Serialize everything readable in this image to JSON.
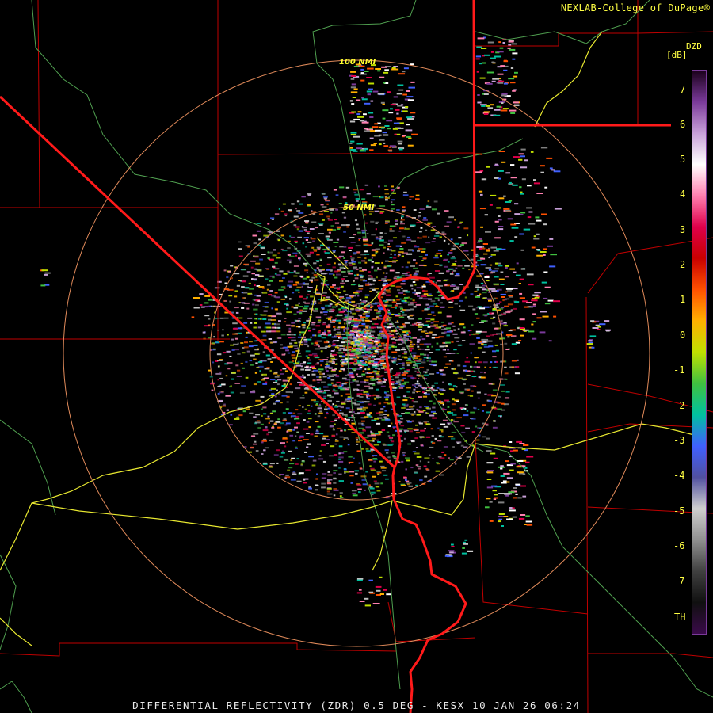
{
  "header": {
    "credit": "NEXLAB-College of DuPage®"
  },
  "footer": {
    "product_line": "DIFFERENTIAL REFLECTIVITY (ZDR) 0.5 DEG - KESX 10 JAN 26 06:24"
  },
  "range_rings": [
    {
      "label": "100 NMI"
    },
    {
      "label": "50 NMI"
    }
  ],
  "legend": {
    "product": "DZD",
    "unit": "[dB]",
    "ticks": [
      "7",
      "6",
      "5",
      "4",
      "3",
      "2",
      "1",
      "0",
      "-1",
      "-2",
      "-3",
      "-4",
      "-5",
      "-6",
      "-7",
      "TH"
    ],
    "colorstops": [
      "#1a001a",
      "#7a3a9a",
      "#c8a0d8",
      "#ffffff",
      "#ff80b0",
      "#e0004a",
      "#c80000",
      "#ff5000",
      "#ffb000",
      "#c0e000",
      "#40c040",
      "#00c0a0",
      "#4060ff",
      "#5050a0",
      "#d0d0d0",
      "#909090",
      "#404040",
      "#101010",
      "#3a0a4a"
    ]
  },
  "colors": {
    "state_border": "#ff1a1a",
    "county_border": "#c00000",
    "highway": "#e8e830",
    "river": "#50a050",
    "range_ring": "#e08a5a"
  }
}
